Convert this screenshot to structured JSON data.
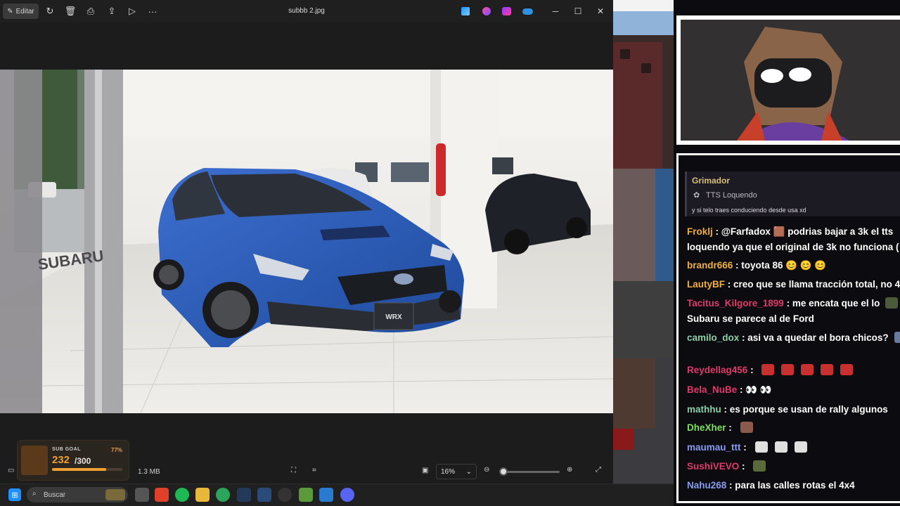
{
  "viewer": {
    "edit_label": "Editar",
    "file_title": "subbb 2.jpg",
    "file_size": "1.3 MB",
    "zoom_value": "16%",
    "zoom_level": 0.02,
    "toolbar_icons": [
      "rotate-icon",
      "delete-icon",
      "print-icon",
      "share-icon",
      "slideshow-icon",
      "more-icon"
    ],
    "app_icons": [
      "designer-icon",
      "clipchamp-icon",
      "copilot-icon",
      "onedrive-icon"
    ],
    "window_controls": [
      "minimize-icon",
      "maximize-icon",
      "close-icon"
    ],
    "photo": {
      "car_badge": "WRX",
      "dealer_sign": "SUBARU"
    }
  },
  "sub_goal": {
    "label": "SUB GOAL",
    "percent": "77%",
    "percent_value": 0.77,
    "current": "232",
    "total": "/300"
  },
  "chat": {
    "tts": {
      "user": "Grimador",
      "type": "TTS Loquendo",
      "message": "y si telo traes conduciendo desde usa xd"
    },
    "messages": [
      {
        "user": "Froklj",
        "color": "#f0b040",
        "text": "@Farfadox  🟫  podrias bajar a 3k el tts"
      },
      {
        "user": "",
        "color": "#ffffff",
        "text": "loquendo ya que el original de 3k no funciona ("
      },
      {
        "user": "brandr666",
        "color": "#f0b040",
        "text": "toyota 86 😊 😊 😊"
      },
      {
        "user": "LautyBF",
        "color": "#f0b040",
        "text": "creo que se llama tracción total, no 4"
      },
      {
        "user": "Tacitus_Kilgore_1899",
        "color": "#e03a6a",
        "text": "me encata que el lo"
      },
      {
        "user": "",
        "color": "#ffffff",
        "text": "Subaru se parece al de Ford"
      },
      {
        "user": "camilo_dox",
        "color": "#8ad0a8",
        "text": "asi va a quedar el bora chicos?"
      },
      {
        "user": "Reydellag456",
        "color": "#e03a6a",
        "text": ""
      },
      {
        "user": "Bela_NuBe",
        "color": "#e03a6a",
        "text": "👀 👀"
      },
      {
        "user": "mathhu",
        "color": "#8ad0a8",
        "text": "es porque se usan de rally algunos"
      },
      {
        "user": "DheXher",
        "color": "#7ce060",
        "text": ""
      },
      {
        "user": "maumau_ttt",
        "color": "#8a9cf0",
        "text": ""
      },
      {
        "user": "SushiVEVO",
        "color": "#e03a6a",
        "text": ""
      },
      {
        "user": "Nahu268",
        "color": "#8a9cf0",
        "text": "para las calles rotas el 4x4"
      }
    ]
  },
  "taskbar": {
    "search_placeholder": "Buscar",
    "apps": [
      "file-manager-icon",
      "brave-icon",
      "spotify-icon",
      "folder-icon",
      "chrome-icon",
      "audio-icon",
      "vpn-icon",
      "obs-icon",
      "minecraft-icon",
      "photos-icon",
      "discord-icon"
    ]
  },
  "colors": {
    "accent_orange": "#f0a030",
    "chat_bg": "#0c0b10",
    "car_blue": "#2f5fb8"
  }
}
